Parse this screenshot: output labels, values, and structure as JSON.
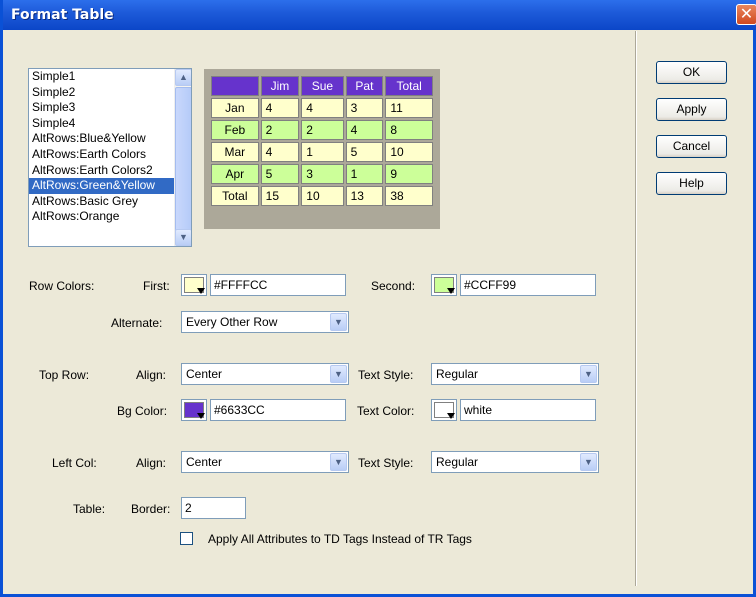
{
  "window": {
    "title": "Format Table",
    "close_glyph": "✕"
  },
  "buttons": {
    "ok": "OK",
    "apply": "Apply",
    "cancel": "Cancel",
    "help": "Help"
  },
  "styles_list": {
    "items": [
      "Simple1",
      "Simple2",
      "Simple3",
      "Simple4",
      "AltRows:Blue&Yellow",
      "AltRows:Earth Colors",
      "AltRows:Earth Colors2",
      "AltRows:Green&Yellow",
      "AltRows:Basic Grey",
      "AltRows:Orange"
    ],
    "selected_index": 7
  },
  "preview": {
    "header": [
      "",
      "Jim",
      "Sue",
      "Pat",
      "Total"
    ],
    "rows": [
      [
        "Jan",
        "4",
        "4",
        "3",
        "11"
      ],
      [
        "Feb",
        "2",
        "2",
        "4",
        "8"
      ],
      [
        "Mar",
        "4",
        "1",
        "5",
        "10"
      ],
      [
        "Apr",
        "5",
        "3",
        "1",
        "9"
      ],
      [
        "Total",
        "15",
        "10",
        "13",
        "38"
      ]
    ],
    "colors": {
      "header": "#6633CC",
      "first": "#FFFFCC",
      "second": "#CCFF99"
    }
  },
  "row_colors": {
    "label": "Row Colors:",
    "first_label": "First:",
    "first_value": "#FFFFCC",
    "first_color": "#FFFFCC",
    "second_label": "Second:",
    "second_value": "#CCFF99",
    "second_color": "#CCFF99",
    "alternate_label": "Alternate:",
    "alternate_value": "Every Other Row"
  },
  "top_row": {
    "label": "Top Row:",
    "align_label": "Align:",
    "align_value": "Center",
    "text_style_label": "Text Style:",
    "text_style_value": "Regular",
    "bg_color_label": "Bg Color:",
    "bg_color_value": "#6633CC",
    "bg_color": "#6633CC",
    "text_color_label": "Text Color:",
    "text_color_value": "white",
    "text_color": "#FFFFFF"
  },
  "left_col": {
    "label": "Left Col:",
    "align_label": "Align:",
    "align_value": "Center",
    "text_style_label": "Text Style:",
    "text_style_value": "Regular"
  },
  "table": {
    "label": "Table:",
    "border_label": "Border:",
    "border_value": "2"
  },
  "apply_td": {
    "label": "Apply All Attributes to TD Tags Instead of TR Tags",
    "checked": false
  }
}
